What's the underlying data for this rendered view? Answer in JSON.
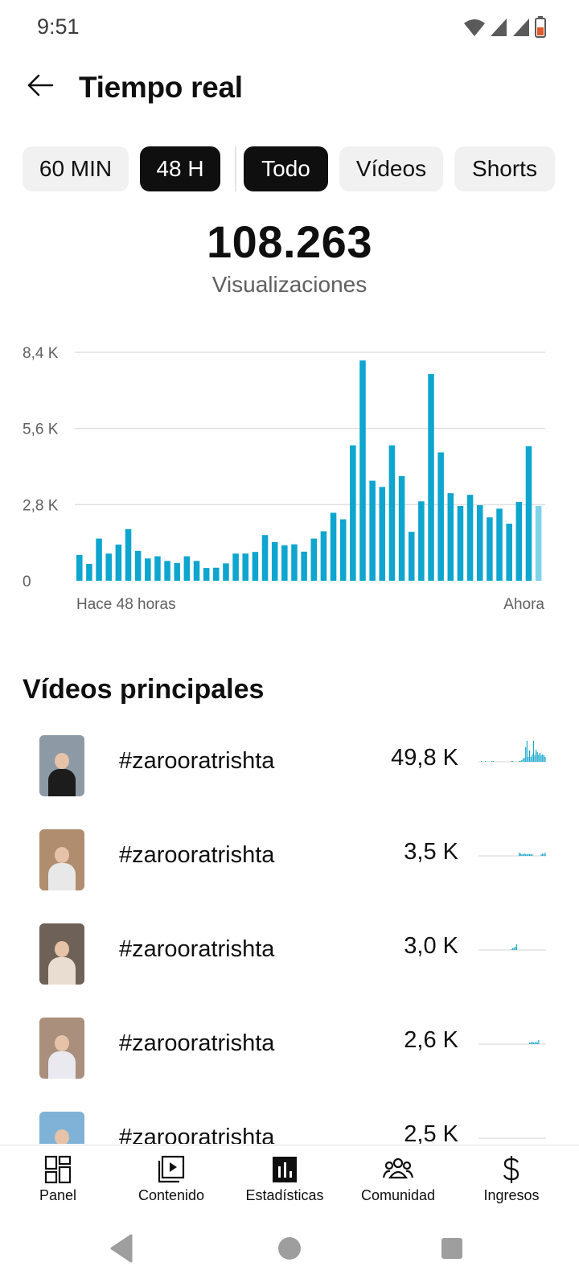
{
  "status_bar": {
    "time": "9:51"
  },
  "header": {
    "title": "Tiempo real"
  },
  "filters": {
    "time_range": [
      {
        "label": "60 MIN",
        "selected": false
      },
      {
        "label": "48 H",
        "selected": true
      }
    ],
    "content_type": [
      {
        "label": "Todo",
        "selected": true
      },
      {
        "label": "Vídeos",
        "selected": false
      },
      {
        "label": "Shorts",
        "selected": false
      }
    ]
  },
  "summary": {
    "total_views": "108.263",
    "label": "Visualizaciones"
  },
  "chart_data": {
    "type": "bar",
    "y_ticks": [
      "0",
      "2,8 K",
      "5,6 K",
      "8,4 K"
    ],
    "ylim": [
      0,
      8400
    ],
    "x_start_label": "Hace 48 horas",
    "x_end_label": "Ahora",
    "bar_color": "#0ea5cf",
    "current_bar_color": "#7fd3ea",
    "values": [
      950,
      620,
      1550,
      1000,
      1330,
      1900,
      1100,
      820,
      900,
      730,
      650,
      900,
      730,
      470,
      480,
      640,
      1000,
      1000,
      1060,
      1680,
      1420,
      1300,
      1340,
      1070,
      1550,
      1820,
      2500,
      2260,
      4980,
      8100,
      3680,
      3450,
      4980,
      3850,
      1800,
      2920,
      7600,
      4720,
      3220,
      2750,
      3160,
      2780,
      2330,
      2650,
      2100,
      2900,
      4950,
      2750
    ]
  },
  "top_videos": {
    "title": "Vídeos principales",
    "items": [
      {
        "title": "#zarooratrishta",
        "views": "49,8 K",
        "spark": [
          0,
          0,
          1,
          0,
          0,
          1,
          0,
          0,
          0,
          0,
          1,
          1,
          0,
          0,
          0,
          0,
          0,
          0,
          0,
          0,
          0,
          0,
          0,
          0,
          0,
          1,
          1,
          0,
          0,
          0,
          0,
          1,
          1,
          2,
          4,
          5,
          18,
          26,
          6,
          14,
          6,
          9,
          26,
          8,
          15,
          12,
          9,
          11,
          8,
          9,
          8,
          6
        ]
      },
      {
        "title": "#zarooratrishta",
        "views": "3,5 K",
        "spark": [
          0,
          0,
          0,
          0,
          0,
          0,
          0,
          0,
          0,
          0,
          0,
          0,
          0,
          0,
          0,
          0,
          0,
          0,
          0,
          0,
          0,
          0,
          0,
          0,
          0,
          0,
          0,
          0,
          0,
          0,
          0,
          4,
          3,
          2,
          2,
          3,
          2,
          2,
          2,
          2,
          2,
          2,
          0,
          0,
          0,
          0,
          0,
          0,
          2,
          3,
          2,
          4
        ]
      },
      {
        "title": "#zarooratrishta",
        "views": "3,0 K",
        "spark": [
          0,
          0,
          0,
          0,
          0,
          0,
          0,
          0,
          0,
          0,
          0,
          0,
          0,
          0,
          0,
          0,
          0,
          0,
          0,
          0,
          0,
          0,
          0,
          0,
          0,
          1,
          2,
          3,
          4,
          7,
          0,
          0,
          0,
          0,
          0,
          0,
          0,
          0,
          0,
          0,
          0,
          0,
          0,
          0,
          0,
          0,
          0,
          0,
          0,
          0,
          0,
          0
        ]
      },
      {
        "title": "#zarooratrishta",
        "views": "2,6 K",
        "spark": [
          0,
          0,
          0,
          0,
          0,
          0,
          0,
          0,
          0,
          0,
          0,
          0,
          0,
          0,
          0,
          0,
          0,
          0,
          0,
          0,
          0,
          0,
          0,
          0,
          0,
          0,
          0,
          0,
          0,
          0,
          0,
          0,
          0,
          0,
          0,
          0,
          0,
          0,
          0,
          2,
          2,
          3,
          2,
          2,
          3,
          2,
          5,
          0,
          0,
          0,
          0,
          0
        ]
      },
      {
        "title": "#zarooratrishta",
        "views": "2,5 K",
        "spark": [
          0,
          0,
          0,
          0,
          0,
          0,
          0,
          0,
          0,
          0,
          0,
          0,
          0,
          0,
          0,
          0,
          0,
          0,
          0,
          0,
          0,
          0,
          0,
          0,
          0,
          0,
          0,
          0,
          0,
          0,
          0,
          0,
          0,
          0,
          0,
          0,
          0,
          0,
          0,
          0,
          0,
          0,
          0,
          0,
          0,
          0,
          0,
          0,
          0,
          0,
          0,
          0
        ]
      }
    ]
  },
  "bottom_nav": [
    {
      "label": "Panel",
      "icon": "dashboard-icon",
      "selected": false
    },
    {
      "label": "Contenido",
      "icon": "content-icon",
      "selected": false
    },
    {
      "label": "Estadísticas",
      "icon": "analytics-icon",
      "selected": true
    },
    {
      "label": "Comunidad",
      "icon": "community-icon",
      "selected": false
    },
    {
      "label": "Ingresos",
      "icon": "dollar-icon",
      "selected": false
    }
  ]
}
